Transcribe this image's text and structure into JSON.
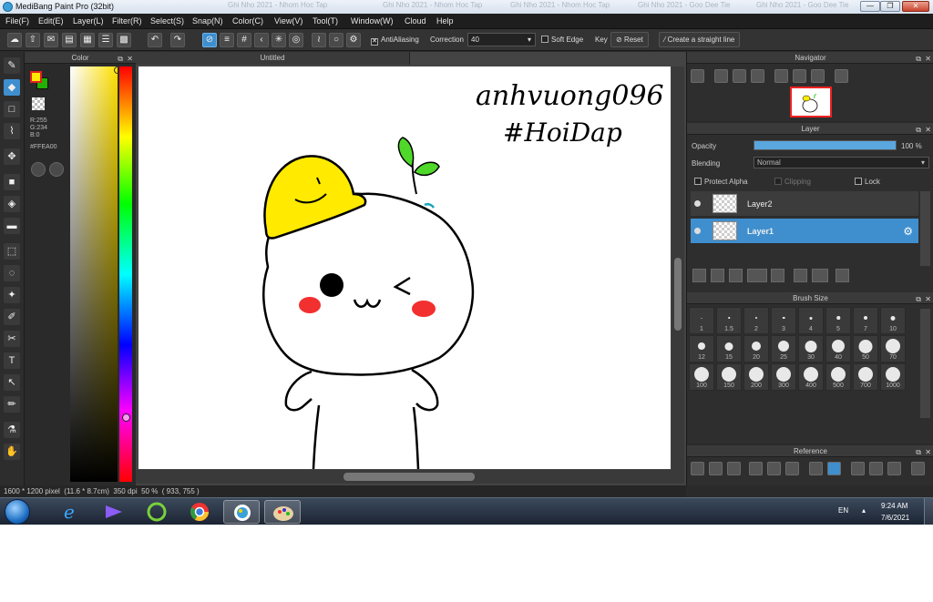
{
  "window": {
    "title": "MediBang Paint Pro (32bit)",
    "bg_tabs": [
      "Ghi Nho 2021 - Nhom Hoc Tap",
      "Ghi Nho 2021 - Nhom Hoc Tap",
      "Ghi Nho 2021 - Nhom Hoc Tap",
      "Ghi Nho 2021 - Goo Dee Tie",
      "Ghi Nho 2021 - Goo Dee Tie"
    ],
    "controls": {
      "minimize": "—",
      "maximize": "❐",
      "close": "✕"
    }
  },
  "menu": [
    "File(F)",
    "Edit(E)",
    "Layer(L)",
    "Filter(R)",
    "Select(S)",
    "Snap(N)",
    "Color(C)",
    "View(V)",
    "Tool(T)",
    "Window(W)",
    "Cloud",
    "Help"
  ],
  "toolbar": {
    "antialiasing_label": "AntiAliasing",
    "correction_label": "Correction",
    "correction_value": "40",
    "soft_edge_label": "Soft Edge",
    "key_label": "Key",
    "reset_label": "Reset",
    "straight_line_label": "Create a straight line"
  },
  "color_panel": {
    "title": "Color",
    "r": "R:255",
    "g": "G:234",
    "b": "B:0",
    "hex": "#FFEA00",
    "foreground": "#ffea00",
    "background": "#22b100"
  },
  "canvas": {
    "tab_title": "Untitled",
    "handwriting_line1": "anhvuong096",
    "handwriting_line2": "#HoiDap"
  },
  "navigator": {
    "title": "Navigator"
  },
  "layer_panel": {
    "title": "Layer",
    "opacity_label": "Opacity",
    "opacity_value": "100 %",
    "opacity_fraction": 1.0,
    "blending_label": "Blending",
    "blending_value": "Normal",
    "protect_alpha_label": "Protect Alpha",
    "clipping_label": "Clipping",
    "lock_label": "Lock",
    "layers": [
      {
        "name": "Layer2",
        "selected": false
      },
      {
        "name": "Layer1",
        "selected": true
      }
    ]
  },
  "brush_panel": {
    "title": "Brush Size",
    "sizes": [
      "1",
      "1.5",
      "2",
      "3",
      "4",
      "5",
      "7",
      "10",
      "12",
      "15",
      "20",
      "25",
      "30",
      "40",
      "50",
      "70",
      "100",
      "150",
      "200",
      "300",
      "400",
      "500",
      "700",
      "1000"
    ]
  },
  "reference_panel": {
    "title": "Reference"
  },
  "status": {
    "size": "1600 * 1200 pixel",
    "physical": "(11.6 * 8.7cm)",
    "dpi": "350 dpi",
    "zoom": "50 %",
    "cursor": "( 933, 755 )"
  },
  "taskbar": {
    "language": "EN",
    "time": "9:24 AM",
    "date": "7/6/2021"
  },
  "colors": {
    "accent": "#3f8fcf",
    "panel": "#2b2b2b"
  }
}
